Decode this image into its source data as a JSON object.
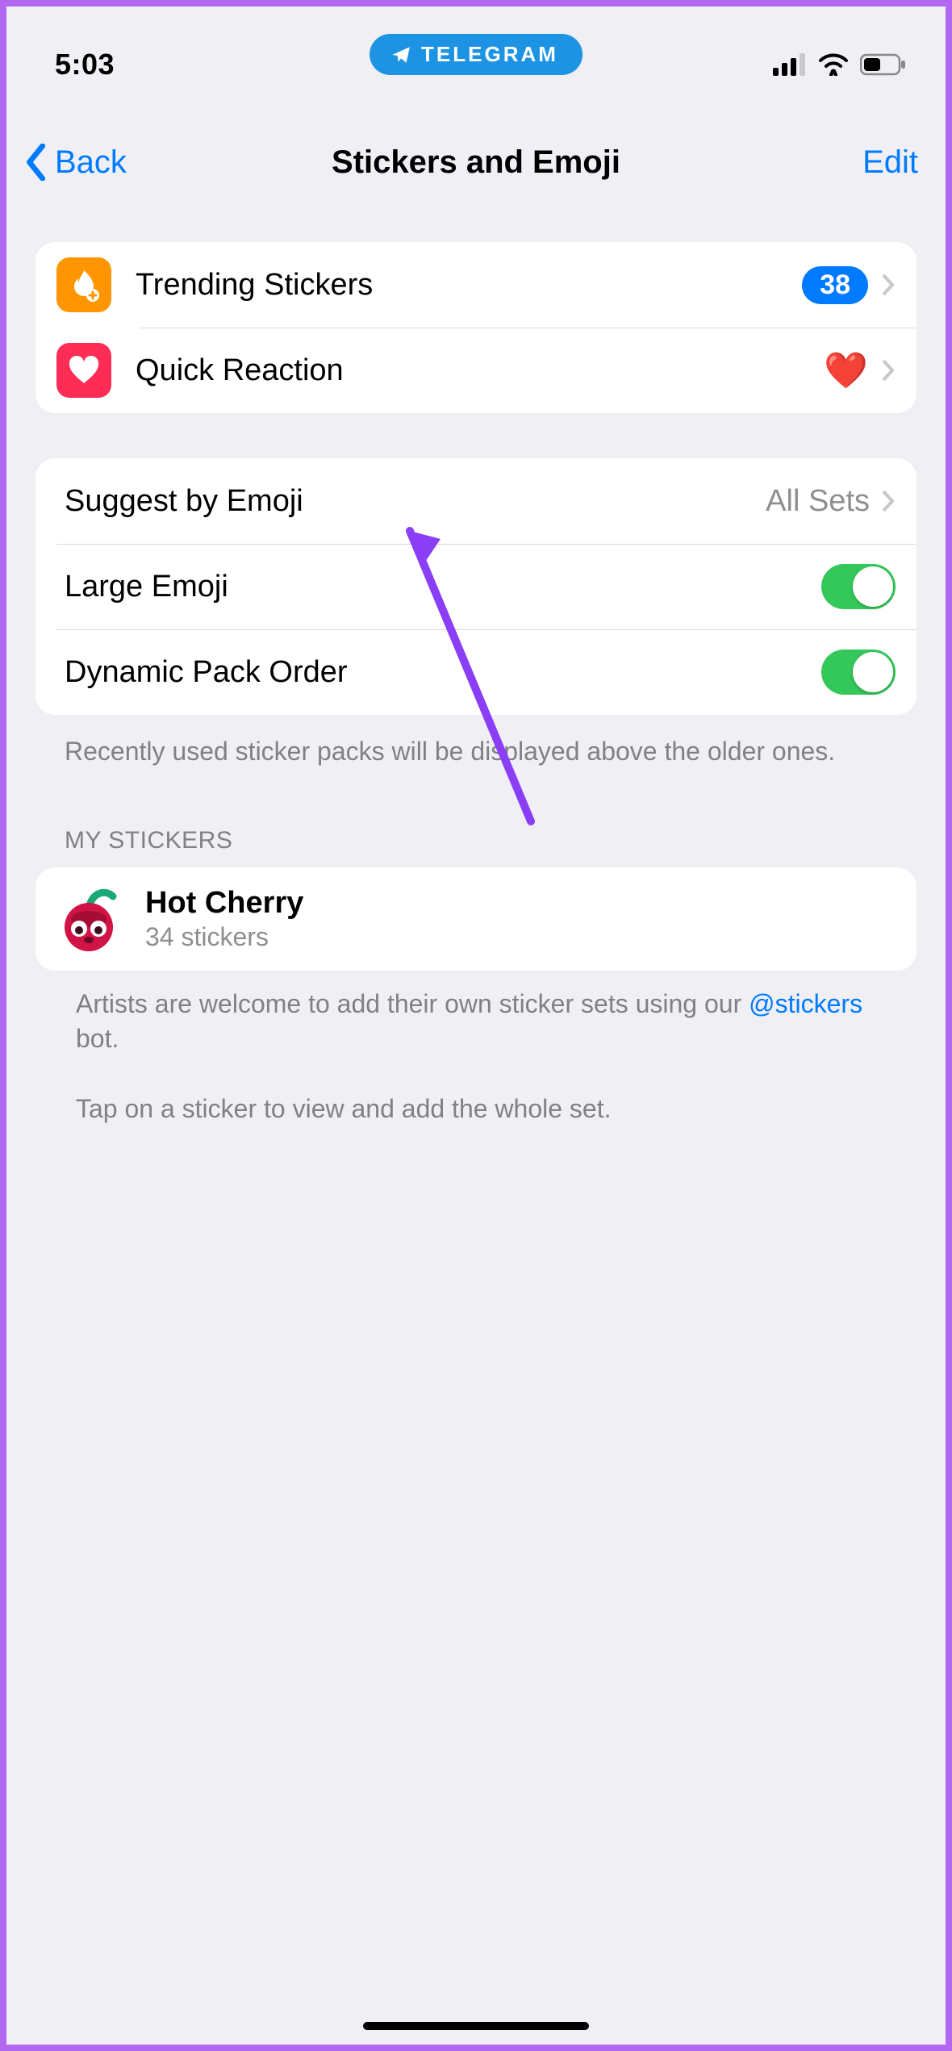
{
  "status": {
    "time": "5:03",
    "app_pill": "TELEGRAM"
  },
  "nav": {
    "back_label": "Back",
    "title": "Stickers and Emoji",
    "edit_label": "Edit"
  },
  "section1": {
    "trending": {
      "label": "Trending Stickers",
      "badge": "38"
    },
    "quick_reaction": {
      "label": "Quick Reaction",
      "emoji": "❤️"
    }
  },
  "section2": {
    "suggest": {
      "label": "Suggest by Emoji",
      "value": "All Sets"
    },
    "large_emoji": {
      "label": "Large Emoji",
      "on": true
    },
    "dynamic_order": {
      "label": "Dynamic Pack Order",
      "on": true
    },
    "footer": "Recently used sticker packs will be displayed above the older ones."
  },
  "my_stickers": {
    "header": "MY STICKERS",
    "pack": {
      "title": "Hot Cherry",
      "sub": "34 stickers"
    },
    "footer_line1_a": "Artists are welcome to add their own sticker sets using our ",
    "footer_link": "@stickers",
    "footer_line1_b": " bot.",
    "footer_line2": "Tap on a sticker to view and add the whole set."
  }
}
